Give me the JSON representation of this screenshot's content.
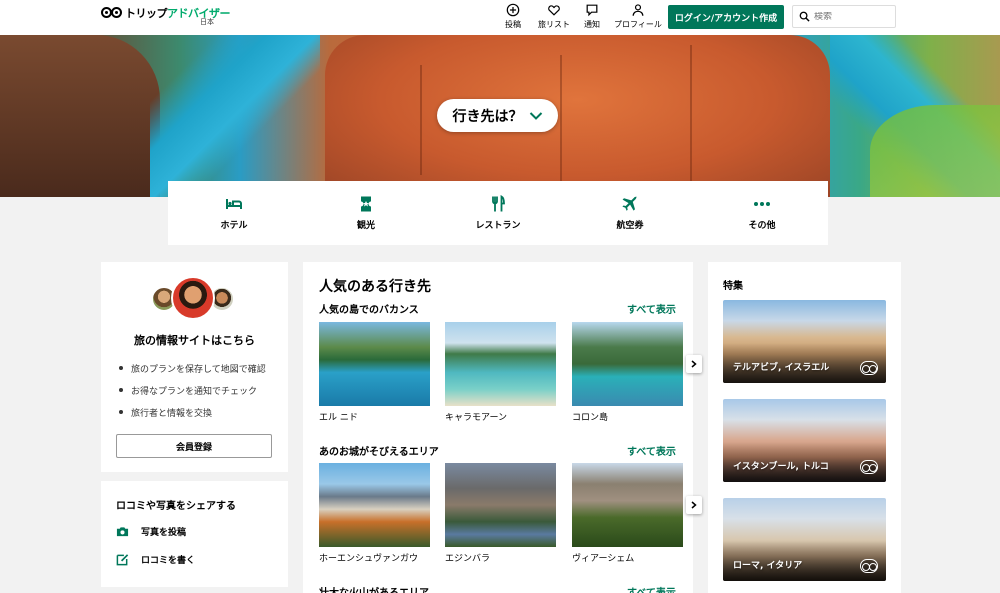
{
  "header": {
    "logo_text_a": "トリップ",
    "logo_text_b": "アドバイザー",
    "logo_sub": "日本",
    "nav": [
      {
        "label": "投稿",
        "icon": "plus-circle-icon"
      },
      {
        "label": "旅リスト",
        "icon": "heart-icon"
      },
      {
        "label": "通知",
        "icon": "speech-bubble-icon"
      },
      {
        "label": "プロフィール",
        "icon": "person-icon"
      }
    ],
    "login_label": "ログイン/アカウント作成",
    "search_placeholder": "検索"
  },
  "hero": {
    "destination_label": "行き先は？"
  },
  "categories": [
    {
      "label": "ホテル",
      "icon": "bed-icon"
    },
    {
      "label": "観光",
      "icon": "ticket-icon"
    },
    {
      "label": "レストラン",
      "icon": "fork-knife-icon"
    },
    {
      "label": "航空券",
      "icon": "airplane-icon"
    },
    {
      "label": "その他",
      "icon": "more-dots-icon"
    }
  ],
  "promo": {
    "title": "旅の情報サイトはこちら",
    "bullets": [
      "旅のプランを保存して地図で確認",
      "お得なプランを通知でチェック",
      "旅行者と情報を交換"
    ],
    "register_label": "会員登録"
  },
  "share": {
    "title": "ロコミや写真をシェアする",
    "items": [
      {
        "label": "写真を投稿",
        "icon": "camera-icon"
      },
      {
        "label": "ロコミを書く",
        "icon": "edit-icon"
      }
    ]
  },
  "popular": {
    "title": "人気のある行き先",
    "see_all": "すべて表示",
    "sections": [
      {
        "title": "人気の島でのバカンス",
        "items": [
          "エル ニド",
          "キャラモアーン",
          "コロン島"
        ]
      },
      {
        "title": "あのお城がそびえるエリア",
        "items": [
          "ホーエンシュヴァンガウ",
          "エジンバラ",
          "ヴィアーシェム"
        ]
      },
      {
        "title": "壮大な火山があるエリア",
        "items": []
      }
    ]
  },
  "featured": {
    "title": "特集",
    "items": [
      "テルアビブ, イスラエル",
      "イスタンブール, トルコ",
      "ローマ, イタリア"
    ]
  },
  "colors": {
    "accent_green": "#00775a",
    "brand_green": "#00aa6c"
  }
}
